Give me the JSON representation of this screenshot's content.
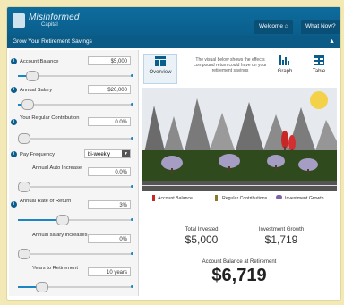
{
  "brand": {
    "name": "Misinformed",
    "tagline": "Capital"
  },
  "nav": {
    "welcome": "Welcome",
    "whatnow": "What Now?"
  },
  "subbar": {
    "title": "Grow Your Retirement Savings"
  },
  "controls": [
    {
      "label": "Account Balance",
      "value": "$5,000",
      "fill_fraction": 0.12
    },
    {
      "label": "Annual Salary",
      "value": "$20,000",
      "fill_fraction": 0.08
    },
    {
      "label": "Your Regular Contribution",
      "value": "0.0%",
      "fill_fraction": 0.05
    },
    {
      "label": "Pay Frequency",
      "value": "bi-weekly"
    },
    {
      "label": "Annual Auto Increase",
      "value": "0.0%",
      "fill_fraction": 0.05
    },
    {
      "label": "Annual Rate of Return",
      "value": "3%",
      "fill_fraction": 0.38
    },
    {
      "label": "Annual salary increases",
      "value": "0%",
      "fill_fraction": 0.05
    },
    {
      "label": "Years to Retirement",
      "value": "10 years",
      "fill_fraction": 0.2
    }
  ],
  "tabs": [
    {
      "label": "Overview",
      "active": true
    },
    {
      "label": "Graph",
      "active": false
    },
    {
      "label": "Table",
      "active": false
    }
  ],
  "note": "The visual below shows the effects compound return could have on your retirement savings",
  "legend": [
    {
      "label": "Account Balance",
      "color": "#c62828"
    },
    {
      "label": "Regular Contributions",
      "color": "#8a7a2a"
    },
    {
      "label": "Investment Growth",
      "color": "#7e63a8"
    }
  ],
  "stats": {
    "total_invested": {
      "label": "Total Invested",
      "value": "$5,000"
    },
    "investment_growth": {
      "label": "Investment Growth",
      "value": "$1,719"
    },
    "balance_at_retirement": {
      "label": "Account Balance at Retirement",
      "value": "$6,719"
    }
  },
  "icons": {
    "welcome": "home-icon",
    "whatnow": "info-icon",
    "collapse": "chevron-up-icon",
    "info": "info-circle-icon",
    "overview": "layout-icon",
    "graph": "bar-chart-icon",
    "table": "table-icon"
  }
}
